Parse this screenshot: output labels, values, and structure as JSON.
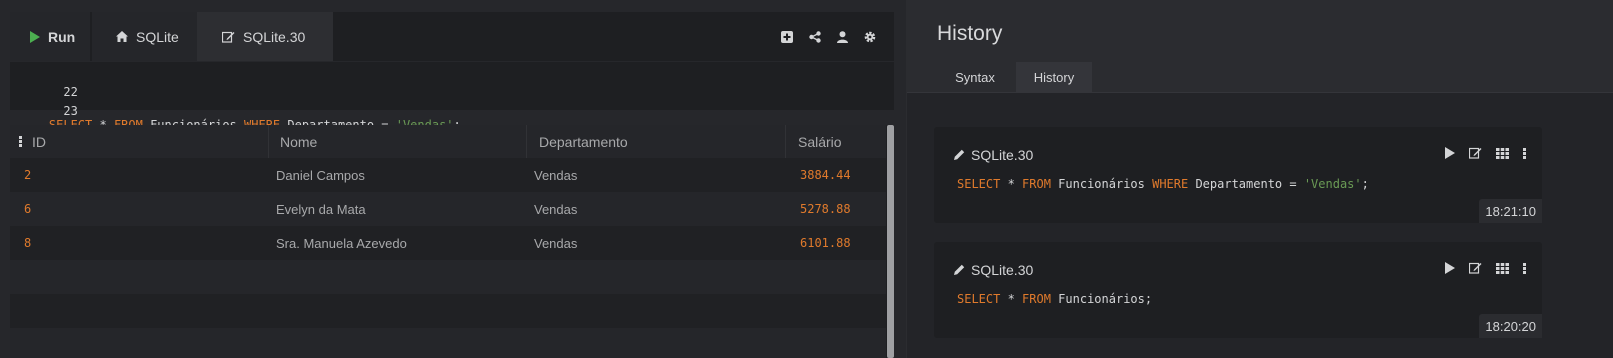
{
  "toolbar": {
    "run_label": "Run",
    "db_tab_label": "SQLite",
    "active_tab_label": "SQLite.30",
    "icons": [
      "add-tab-icon",
      "share-icon",
      "user-icon",
      "settings-icon"
    ]
  },
  "editor": {
    "lines": [
      {
        "number": "22",
        "tokens": []
      },
      {
        "number": "23",
        "tokens": [
          {
            "t": "SELECT",
            "c": "kw"
          },
          {
            "t": " * ",
            "c": ""
          },
          {
            "t": "FROM",
            "c": "kw"
          },
          {
            "t": " Funcionários ",
            "c": ""
          },
          {
            "t": "WHERE",
            "c": "kw"
          },
          {
            "t": " Departamento = ",
            "c": ""
          },
          {
            "t": "'Vendas'",
            "c": "str"
          },
          {
            "t": ";",
            "c": ""
          }
        ]
      }
    ]
  },
  "grid": {
    "columns": [
      "ID",
      "Nome",
      "Departamento",
      "Salário"
    ],
    "rows": [
      [
        "2",
        "Daniel Campos",
        "Vendas",
        "3884.44"
      ],
      [
        "6",
        "Evelyn da Mata",
        "Vendas",
        "5278.88"
      ],
      [
        "8",
        "Sra. Manuela Azevedo",
        "Vendas",
        "6101.88"
      ]
    ]
  },
  "history_panel": {
    "title": "History",
    "tabs": [
      "Syntax",
      "History"
    ],
    "active_tab": "History",
    "entries": [
      {
        "name": "SQLite.30",
        "sql": [
          {
            "t": "SELECT",
            "c": "kw"
          },
          {
            "t": " * ",
            "c": ""
          },
          {
            "t": "FROM",
            "c": "kw"
          },
          {
            "t": " Funcionários ",
            "c": ""
          },
          {
            "t": "WHERE",
            "c": "kw"
          },
          {
            "t": " Departamento = ",
            "c": ""
          },
          {
            "t": "'Vendas'",
            "c": "str"
          },
          {
            "t": ";",
            "c": ""
          }
        ],
        "time": "18:21:10"
      },
      {
        "name": "SQLite.30",
        "sql": [
          {
            "t": "SELECT",
            "c": "kw"
          },
          {
            "t": " * ",
            "c": ""
          },
          {
            "t": "FROM",
            "c": "kw"
          },
          {
            "t": " Funcionários;",
            "c": ""
          }
        ],
        "time": "18:20:20"
      }
    ]
  },
  "colors": {
    "keyword": "#e07a2c",
    "string": "#6a9a55",
    "run_icon": "#4caf50"
  }
}
